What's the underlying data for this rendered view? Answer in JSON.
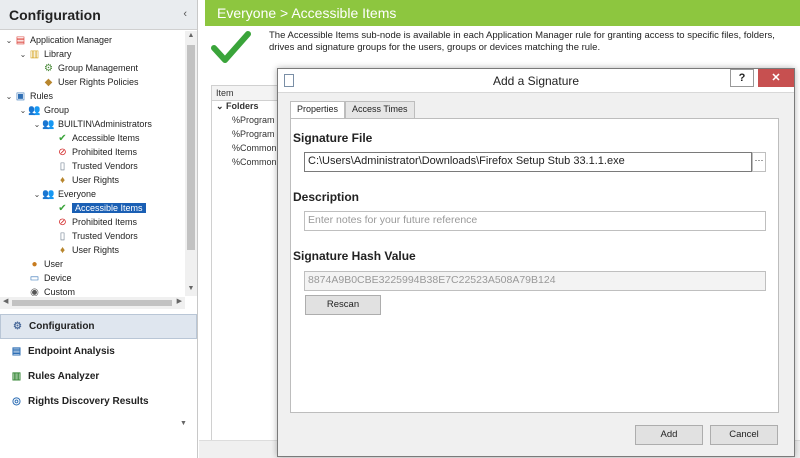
{
  "left_pane": {
    "title": "Configuration",
    "tree": [
      {
        "label": "Application Manager",
        "depth": 0,
        "expander": "⌄",
        "icon": "app-manager-icon",
        "glyph": "▤",
        "color": "#d9342b"
      },
      {
        "label": "Library",
        "depth": 1,
        "expander": "⌄",
        "icon": "library-icon",
        "glyph": "▥",
        "color": "#d4a017"
      },
      {
        "label": "Group Management",
        "depth": 2,
        "expander": "",
        "icon": "group-management-icon",
        "glyph": "⚙",
        "color": "#4b8b3b"
      },
      {
        "label": "User Rights Policies",
        "depth": 2,
        "expander": "",
        "icon": "user-rights-policies-icon",
        "glyph": "◆",
        "color": "#b8862e"
      },
      {
        "label": "Rules",
        "depth": 0,
        "expander": "⌄",
        "icon": "rules-icon",
        "glyph": "▣",
        "color": "#2f6fb5"
      },
      {
        "label": "Group",
        "depth": 1,
        "expander": "⌄",
        "icon": "group-icon",
        "glyph": "👥",
        "color": "#c77b1e"
      },
      {
        "label": "BUILTIN\\Administrators",
        "depth": 2,
        "expander": "⌄",
        "icon": "group-icon",
        "glyph": "👥",
        "color": "#c77b1e"
      },
      {
        "label": "Accessible Items",
        "depth": 3,
        "expander": "",
        "icon": "check-icon",
        "glyph": "✔",
        "color": "#3aa43a"
      },
      {
        "label": "Prohibited Items",
        "depth": 3,
        "expander": "",
        "icon": "prohibited-icon",
        "glyph": "⊘",
        "color": "#d02020"
      },
      {
        "label": "Trusted Vendors",
        "depth": 3,
        "expander": "",
        "icon": "document-icon",
        "glyph": "▯",
        "color": "#6b7a8c"
      },
      {
        "label": "User Rights",
        "depth": 3,
        "expander": "",
        "icon": "user-rights-icon",
        "glyph": "♦",
        "color": "#b8862e"
      },
      {
        "label": "Everyone",
        "depth": 2,
        "expander": "⌄",
        "icon": "group-icon",
        "glyph": "👥",
        "color": "#c77b1e"
      },
      {
        "label": "Accessible Items",
        "depth": 3,
        "expander": "",
        "icon": "check-icon",
        "glyph": "✔",
        "color": "#3aa43a",
        "selected": true
      },
      {
        "label": "Prohibited Items",
        "depth": 3,
        "expander": "",
        "icon": "prohibited-icon",
        "glyph": "⊘",
        "color": "#d02020"
      },
      {
        "label": "Trusted Vendors",
        "depth": 3,
        "expander": "",
        "icon": "document-icon",
        "glyph": "▯",
        "color": "#6b7a8c"
      },
      {
        "label": "User Rights",
        "depth": 3,
        "expander": "",
        "icon": "user-rights-icon",
        "glyph": "♦",
        "color": "#b8862e"
      },
      {
        "label": "User",
        "depth": 1,
        "expander": "",
        "icon": "user-icon",
        "glyph": "●",
        "color": "#c77b1e"
      },
      {
        "label": "Device",
        "depth": 1,
        "expander": "",
        "icon": "device-icon",
        "glyph": "▭",
        "color": "#2f6fb5"
      },
      {
        "label": "Custom",
        "depth": 1,
        "expander": "",
        "icon": "custom-icon",
        "glyph": "◉",
        "color": "#555555"
      }
    ],
    "nav_buttons": [
      {
        "label": "Configuration",
        "icon": "configuration-icon",
        "glyph": "⚙",
        "color": "#4b6b9b",
        "active": true
      },
      {
        "label": "Endpoint Analysis",
        "icon": "endpoint-analysis-icon",
        "glyph": "▤",
        "color": "#2f6fb5"
      },
      {
        "label": "Rules Analyzer",
        "icon": "rules-analyzer-icon",
        "glyph": "▥",
        "color": "#3a8a3a"
      },
      {
        "label": "Rights Discovery Results",
        "icon": "rights-discovery-icon",
        "glyph": "◎",
        "color": "#2f6fb5"
      }
    ]
  },
  "content": {
    "header": "Everyone > Accessible Items",
    "description": "The Accessible Items sub-node is available in each Application Manager rule for granting access to specific files, folders, drives and signature groups for the users, groups or devices matching the rule.",
    "list_header": "Item",
    "list_group": "Folders",
    "list_rows": [
      "%Program",
      "%Program",
      "%Common",
      "%Common"
    ]
  },
  "dialog": {
    "title": "Add a Signature",
    "help_label": "?",
    "close_label": "✕",
    "tabs": [
      "Properties",
      "Access Times"
    ],
    "signature_file_label": "Signature File",
    "signature_file_value": "C:\\Users\\Administrator\\Downloads\\Firefox Setup Stub 33.1.1.exe",
    "browse_label": "···",
    "description_label": "Description",
    "description_placeholder": "Enter notes for your future reference",
    "hash_label": "Signature Hash Value",
    "hash_value": "8874A9B0CBE3225994B38E7C22523A508A79B124",
    "rescan_label": "Rescan",
    "add_label": "Add",
    "cancel_label": "Cancel"
  },
  "colors": {
    "accent_green": "#8dc63f",
    "selection_blue": "#1a5fb4",
    "close_red": "#c75050"
  }
}
